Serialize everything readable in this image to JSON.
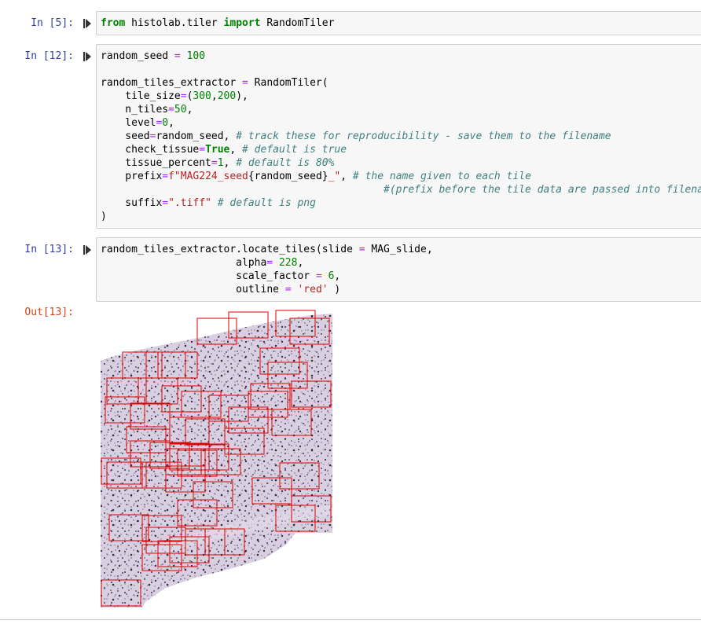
{
  "cells": [
    {
      "prompt": "In [5]:",
      "lines": [
        [
          [
            "kw",
            "from"
          ],
          [
            "t",
            " histolab.tiler "
          ],
          [
            "kw",
            "import"
          ],
          [
            "t",
            " RandomTiler"
          ]
        ]
      ]
    },
    {
      "prompt": "In [12]:",
      "lines": [
        [
          [
            "t",
            "random_seed "
          ],
          [
            "op",
            "="
          ],
          [
            "t",
            " "
          ],
          [
            "num",
            "100"
          ]
        ],
        [],
        [
          [
            "t",
            "random_tiles_extractor "
          ],
          [
            "op",
            "="
          ],
          [
            "t",
            " RandomTiler("
          ]
        ],
        [
          [
            "t",
            "    tile_size"
          ],
          [
            "op",
            "="
          ],
          [
            "t",
            "("
          ],
          [
            "num",
            "300"
          ],
          [
            "t",
            ","
          ],
          [
            "num",
            "200"
          ],
          [
            "t",
            "),"
          ]
        ],
        [
          [
            "t",
            "    n_tiles"
          ],
          [
            "op",
            "="
          ],
          [
            "num",
            "50"
          ],
          [
            "t",
            ","
          ]
        ],
        [
          [
            "t",
            "    level"
          ],
          [
            "op",
            "="
          ],
          [
            "num",
            "0"
          ],
          [
            "t",
            ","
          ]
        ],
        [
          [
            "t",
            "    seed"
          ],
          [
            "op",
            "="
          ],
          [
            "t",
            "random_seed, "
          ],
          [
            "cm",
            "# track these for reproducibility - save them to the filename"
          ]
        ],
        [
          [
            "t",
            "    check_tissue"
          ],
          [
            "op",
            "="
          ],
          [
            "kw",
            "True"
          ],
          [
            "t",
            ", "
          ],
          [
            "cm",
            "# default is true"
          ]
        ],
        [
          [
            "t",
            "    tissue_percent"
          ],
          [
            "op",
            "="
          ],
          [
            "num",
            "1"
          ],
          [
            "t",
            ", "
          ],
          [
            "cm",
            "# default is 80%"
          ]
        ],
        [
          [
            "t",
            "    prefix"
          ],
          [
            "op",
            "="
          ],
          [
            "str",
            "f\"MAG224_seed"
          ],
          [
            "t",
            "{random_seed}"
          ],
          [
            "str",
            "_\""
          ],
          [
            "t",
            ", "
          ],
          [
            "cm",
            "# the name given to each tile"
          ]
        ],
        [
          [
            "t",
            "                                              "
          ],
          [
            "cm",
            "#(prefix before the tile data are passed into filename )"
          ]
        ],
        [
          [
            "t",
            "    suffix"
          ],
          [
            "op",
            "="
          ],
          [
            "str",
            "\".tiff\""
          ],
          [
            "t",
            " "
          ],
          [
            "cm",
            "# default is png"
          ]
        ],
        [
          [
            "t",
            ")"
          ]
        ]
      ]
    },
    {
      "prompt": "In [13]:",
      "lines": [
        [
          [
            "t",
            "random_tiles_extractor.locate_tiles(slide "
          ],
          [
            "op",
            "="
          ],
          [
            "t",
            " MAG_slide,"
          ]
        ],
        [
          [
            "t",
            "                      alpha"
          ],
          [
            "op",
            "="
          ],
          [
            "t",
            " "
          ],
          [
            "num",
            "228"
          ],
          [
            "t",
            ","
          ]
        ],
        [
          [
            "t",
            "                      scale_factor "
          ],
          [
            "op",
            "="
          ],
          [
            "t",
            " "
          ],
          [
            "num",
            "6"
          ],
          [
            "t",
            ","
          ]
        ],
        [
          [
            "t",
            "                      outline "
          ],
          [
            "op",
            "="
          ],
          [
            "t",
            " "
          ],
          [
            "str",
            "'red'"
          ],
          [
            "t",
            " )"
          ]
        ]
      ]
    }
  ],
  "output_prompt": "Out[13]:",
  "output_image": {
    "kind": "slide-thumbnail-with-tile-outlines",
    "outline_color": "#e00000",
    "tissue_color": "#d9cfe0",
    "outlined_tile_count": 50
  }
}
